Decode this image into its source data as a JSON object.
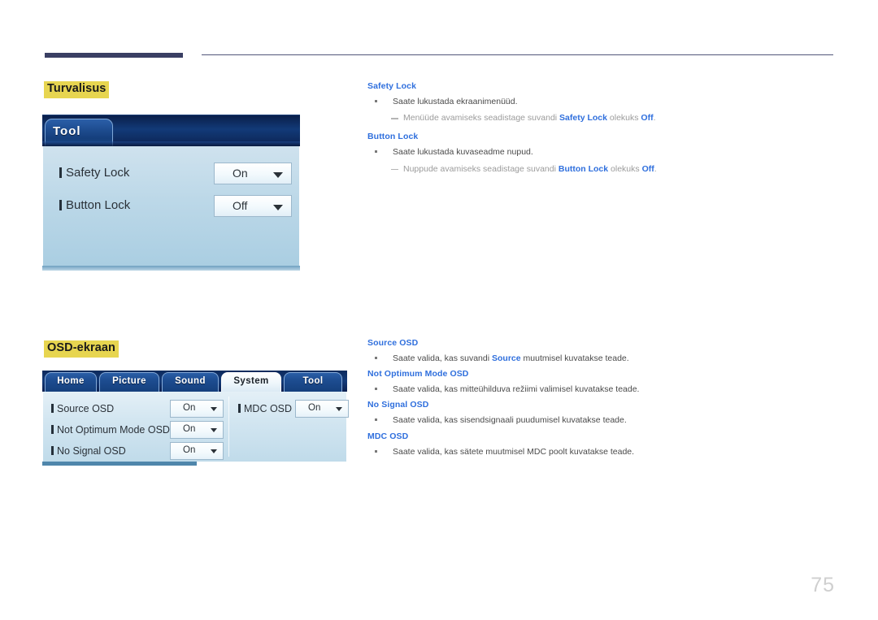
{
  "page": {
    "number": "75"
  },
  "sections": [
    {
      "heading": "Turvalisus",
      "mock": {
        "type": "tool-panel",
        "tab_label": "Tool",
        "rows": [
          {
            "label": "Safety Lock",
            "value": "On"
          },
          {
            "label": "Button Lock",
            "value": "Off"
          }
        ]
      },
      "text_blocks": [
        {
          "title": "Safety Lock",
          "bullet": "Saate lukustada ekraanimenüüd.",
          "sub_parts": [
            {
              "text": "Menüüde avamiseks seadistage suvandi ",
              "bold": false
            },
            {
              "text": "Safety Lock",
              "bold": true
            },
            {
              "text": " olekuks ",
              "bold": false
            },
            {
              "text": "Off",
              "bold": true
            },
            {
              "text": ".",
              "bold": false
            }
          ]
        },
        {
          "title": "Button Lock",
          "bullet": "Saate lukustada kuvaseadme nupud.",
          "sub_parts": [
            {
              "text": "Nuppude avamiseks seadistage suvandi ",
              "bold": false
            },
            {
              "text": "Button Lock",
              "bold": true
            },
            {
              "text": " olekuks ",
              "bold": false
            },
            {
              "text": "Off",
              "bold": true
            },
            {
              "text": ".",
              "bold": false
            }
          ]
        }
      ]
    },
    {
      "heading": "OSD-ekraan",
      "mock": {
        "type": "system-panel",
        "tabs": [
          {
            "label": "Home",
            "active": false
          },
          {
            "label": "Picture",
            "active": false
          },
          {
            "label": "Sound",
            "active": false
          },
          {
            "label": "System",
            "active": true
          },
          {
            "label": "Tool",
            "active": false
          }
        ],
        "left_rows": [
          {
            "label": "Source OSD",
            "value": "On"
          },
          {
            "label": "Not Optimum Mode OSD",
            "value": "On"
          },
          {
            "label": "No Signal OSD",
            "value": "On"
          }
        ],
        "right_rows": [
          {
            "label": "MDC OSD",
            "value": "On"
          }
        ]
      },
      "text_blocks": [
        {
          "title": "Source OSD",
          "bullet_parts": [
            {
              "text": "Saate valida, kas suvandi ",
              "bold": false
            },
            {
              "text": "Source",
              "bold": true
            },
            {
              "text": " muutmisel kuvatakse teade.",
              "bold": false
            }
          ]
        },
        {
          "title": "Not Optimum Mode OSD",
          "bullet_parts": [
            {
              "text": "Saate valida, kas mitteühilduva režiimi valimisel kuvatakse teade.",
              "bold": false
            }
          ]
        },
        {
          "title": "No Signal OSD",
          "bullet_parts": [
            {
              "text": "Saate valida, kas sisendsignaali puudumisel kuvatakse teade.",
              "bold": false
            }
          ]
        },
        {
          "title": "MDC OSD",
          "bullet_parts": [
            {
              "text": "Saate valida, kas sätete muutmisel MDC poolt kuvatakse teade.",
              "bold": false
            }
          ]
        }
      ]
    }
  ],
  "colors": {
    "heading_highlight": "#e7d550",
    "link_blue": "#2f6fdd",
    "header_bar": "#3a3f63",
    "page_number": "#cfcfcf"
  }
}
